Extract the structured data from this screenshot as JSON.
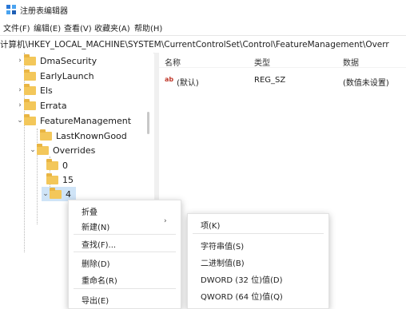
{
  "window": {
    "title": "注册表编辑器"
  },
  "menubar": {
    "items": [
      "文件(F)",
      "编辑(E)",
      "查看(V)",
      "收藏夹(A)",
      "帮助(H)"
    ]
  },
  "address": {
    "path": "计算机\\HKEY_LOCAL_MACHINE\\SYSTEM\\CurrentControlSet\\Control\\FeatureManagement\\Overr"
  },
  "tree": {
    "items": [
      {
        "label": "DmaSecurity"
      },
      {
        "label": "EarlyLaunch"
      },
      {
        "label": "Els"
      },
      {
        "label": "Errata"
      },
      {
        "label": "FeatureManagement"
      },
      {
        "label": "LastKnownGood"
      },
      {
        "label": "Overrides"
      },
      {
        "label": "0"
      },
      {
        "label": "15"
      },
      {
        "label": "4"
      }
    ]
  },
  "list": {
    "headers": {
      "name": "名称",
      "type": "类型",
      "data": "数据"
    },
    "rows": [
      {
        "icon": "ab",
        "name": "(默认)",
        "type": "REG_SZ",
        "data": "(数值未设置)"
      }
    ]
  },
  "context_menu": {
    "items": [
      "折叠",
      "新建(N)",
      "查找(F)...",
      "删除(D)",
      "重命名(R)",
      "导出(E)"
    ]
  },
  "new_submenu": {
    "items": [
      "项(K)",
      "字符串值(S)",
      "二进制值(B)",
      "DWORD (32 位)值(D)",
      "QWORD (64 位)值(Q)"
    ]
  }
}
